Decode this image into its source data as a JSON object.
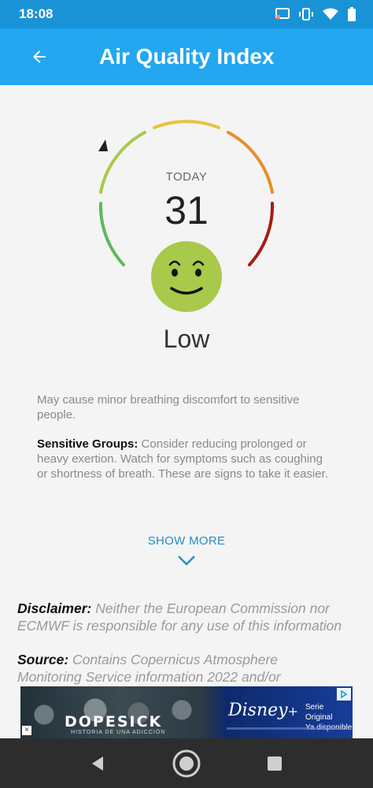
{
  "status_bar": {
    "time": "18:08",
    "icons": [
      "cast-icon",
      "vibrate-icon",
      "wifi-icon",
      "battery-icon"
    ]
  },
  "app_bar": {
    "title": "Air Quality Index",
    "back_icon": "arrow-left-icon",
    "color": "#22a7f0"
  },
  "aqi": {
    "day_label": "TODAY",
    "value": "31",
    "level": "Low",
    "face_icon": "smiley-face-icon",
    "face_color": "#a9c94a",
    "gauge_colors": [
      "#5fb85a",
      "#a9c94a",
      "#e9c33a",
      "#e58f2a",
      "#a51c12"
    ]
  },
  "description": {
    "summary": "May cause minor breathing discomfort to sensitive people.",
    "sensitive_label": "Sensitive Groups:",
    "sensitive_text": "Consider reducing prolonged or heavy exertion. Watch for symptoms such as coughing or shortness of breath. These are signs to take it easier."
  },
  "show_more": {
    "label": "SHOW MORE",
    "icon": "chevron-down-icon"
  },
  "disclaimer": {
    "label": "Disclaimer:",
    "line1": "Neither the European Commission nor",
    "line2": "ECMWF is responsible for any use of this information"
  },
  "source": {
    "label": "Source:",
    "line1": "Contains Copernicus Atmosphere",
    "line2": "Monitoring Service information 2022 and/or"
  },
  "ad": {
    "title": "DOPESICK",
    "tagline": "HISTORIA DE UNA ADICCIÓN",
    "brand": "Disney",
    "brand_plus": "+",
    "promo_line1": "Serie Original",
    "promo_line2": "Ya disponible"
  },
  "nav": {
    "back_icon": "nav-back-icon",
    "home_icon": "nav-home-icon",
    "recents_icon": "nav-recents-icon"
  }
}
